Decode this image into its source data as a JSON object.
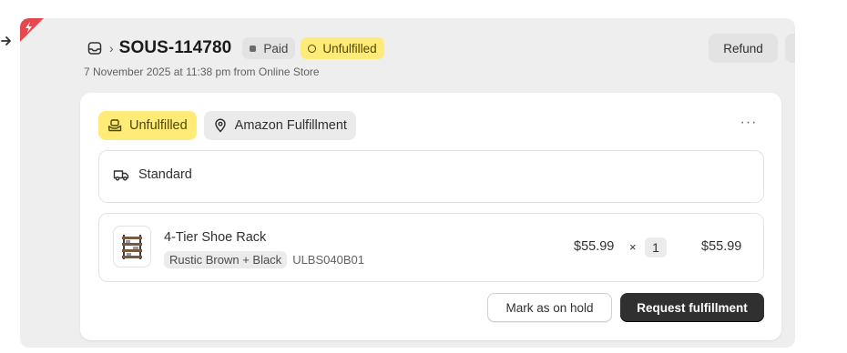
{
  "order": {
    "title": "SOUS-114780",
    "payment_status": "Paid",
    "fulfillment_status": "Unfulfilled",
    "subtitle": "7 November 2025 at 11:38 pm from Online Store"
  },
  "actions": {
    "refund_label": "Refund",
    "more_label": "···",
    "hold_label": "Mark as on hold",
    "request_label": "Request fulfillment"
  },
  "fulfillment": {
    "status_label": "Unfulfilled",
    "location_label": "Amazon Fulfillment",
    "shipping_label": "Standard"
  },
  "line_item": {
    "name": "4-Tier Shoe Rack",
    "variant": "Rustic Brown + Black",
    "sku": "ULBS040B01",
    "unit_price": "$55.99",
    "times": "×",
    "quantity": "1",
    "total": "$55.99"
  },
  "icons": {
    "back": "arrow-right-icon",
    "order": "inbox-icon",
    "breadcrumb": "chevron-right-icon",
    "unfulfilled": "hand-box-icon",
    "location": "location-pin-icon",
    "shipping": "truck-icon",
    "thumbnail": "shoe-rack-image",
    "corner": "alert-flash-icon"
  },
  "colors": {
    "unfulfilled_bg": "#ffeb78",
    "paid_bg": "#e3e3e3",
    "primary_btn": "#303030",
    "corner_badge": "#e5484d"
  }
}
